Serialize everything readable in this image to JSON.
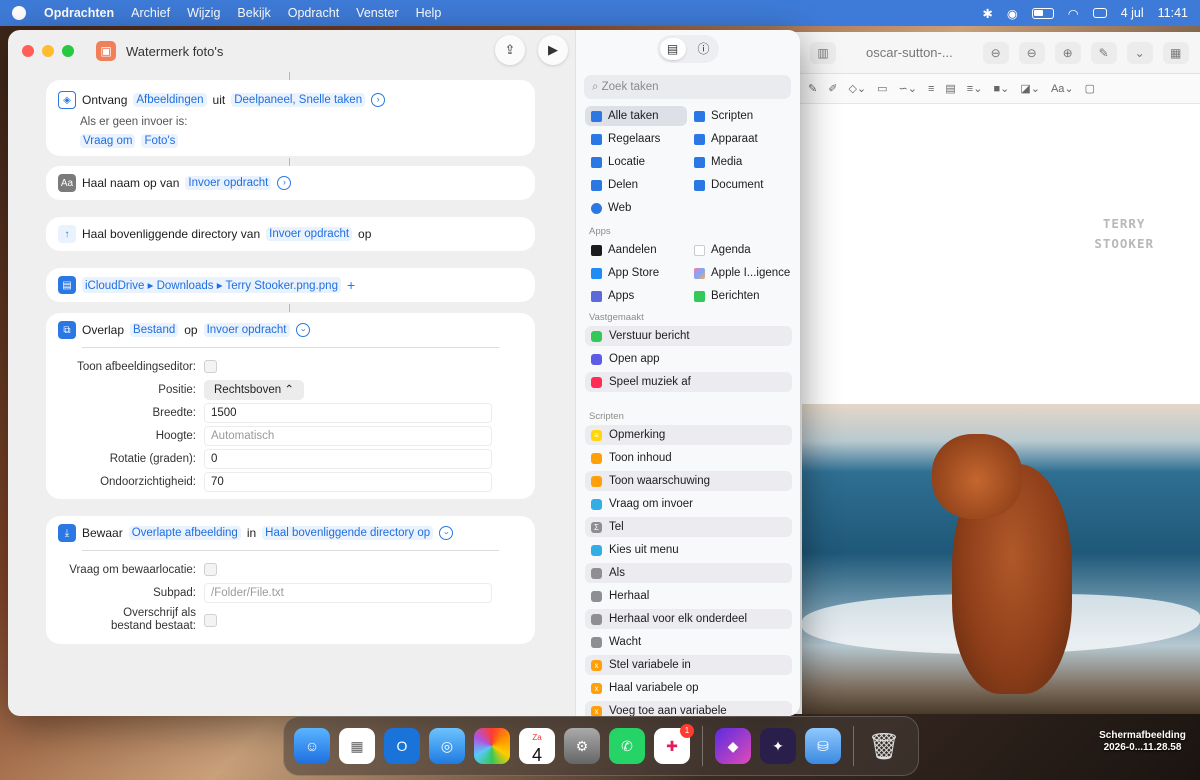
{
  "menubar": {
    "app_name": "Opdrachten",
    "items": [
      "Archief",
      "Wijzig",
      "Bekijk",
      "Opdracht",
      "Venster",
      "Help"
    ],
    "date": "4 jul",
    "time": "11:41"
  },
  "preview": {
    "title": "oscar-sutton-...",
    "watermark_line1": "TERRY",
    "watermark_line2": "STOOKER"
  },
  "window": {
    "title": "Watermerk foto's"
  },
  "actions": {
    "receive": {
      "label": "Ontvang",
      "type": "Afbeeldingen",
      "from_word": "uit",
      "source": "Deelpaneel, Snelle taken",
      "no_input_label": "Als er geen invoer is:",
      "ask": "Vraag om",
      "ask_target": "Foto's"
    },
    "get_name": {
      "label": "Haal naam op van",
      "input": "Invoer opdracht"
    },
    "parent_dir": {
      "label": "Haal bovenliggende directory van",
      "input": "Invoer opdracht",
      "suffix": "op"
    },
    "file_path": {
      "path": "iCloudDrive ▸ Downloads ▸ Terry Stooker.png.png"
    },
    "overlay": {
      "label": "Overlap",
      "item": "Bestand",
      "on_word": "op",
      "target": "Invoer opdracht",
      "params": {
        "show_editor_label": "Toon afbeeldingseditor:",
        "position_label": "Positie:",
        "position_value": "Rechtsboven",
        "width_label": "Breedte:",
        "width_value": "1500",
        "height_label": "Hoogte:",
        "height_placeholder": "Automatisch",
        "rotation_label": "Rotatie (graden):",
        "rotation_value": "0",
        "opacity_label": "Ondoorzichtigheid:",
        "opacity_value": "70"
      }
    },
    "save": {
      "label": "Bewaar",
      "item": "Overlapte afbeelding",
      "in_word": "in",
      "target": "Haal bovenliggende directory op",
      "params": {
        "ask_location_label": "Vraag om bewaarlocatie:",
        "subpath_label": "Subpad:",
        "subpath_placeholder": "/Folder/File.txt",
        "overwrite_label_1": "Overschrijf als",
        "overwrite_label_2": "bestand bestaat:"
      }
    }
  },
  "sidebar": {
    "search_placeholder": "Zoek taken",
    "categories_left": [
      "Alle taken",
      "Regelaars",
      "Locatie",
      "Delen",
      "Web"
    ],
    "categories_right": [
      "Scripten",
      "Apparaat",
      "Media",
      "Document"
    ],
    "apps_header": "Apps",
    "apps_left": [
      "Aandelen",
      "App Store",
      "Apps"
    ],
    "apps_right": [
      "Agenda",
      "Apple I...igence",
      "Berichten"
    ],
    "pinned_header": "Vastgemaakt",
    "pinned": [
      "Verstuur bericht",
      "Open app",
      "Speel muziek af"
    ],
    "scripts_header": "Scripten",
    "scripts": [
      "Opmerking",
      "Toon inhoud",
      "Toon waarschuwing",
      "Vraag om invoer",
      "Tel",
      "Kies uit menu",
      "Als",
      "Herhaal",
      "Herhaal voor elk onderdeel",
      "Wacht",
      "Stel variabele in",
      "Haal variabele op",
      "Voeg toe aan variabele"
    ]
  },
  "dock": {
    "calendar_month": "Za",
    "calendar_day": "4",
    "slack_badge": "1"
  },
  "screenshot_label_1": "Schermafbeelding",
  "screenshot_label_2": "2026-0...11.28.58"
}
